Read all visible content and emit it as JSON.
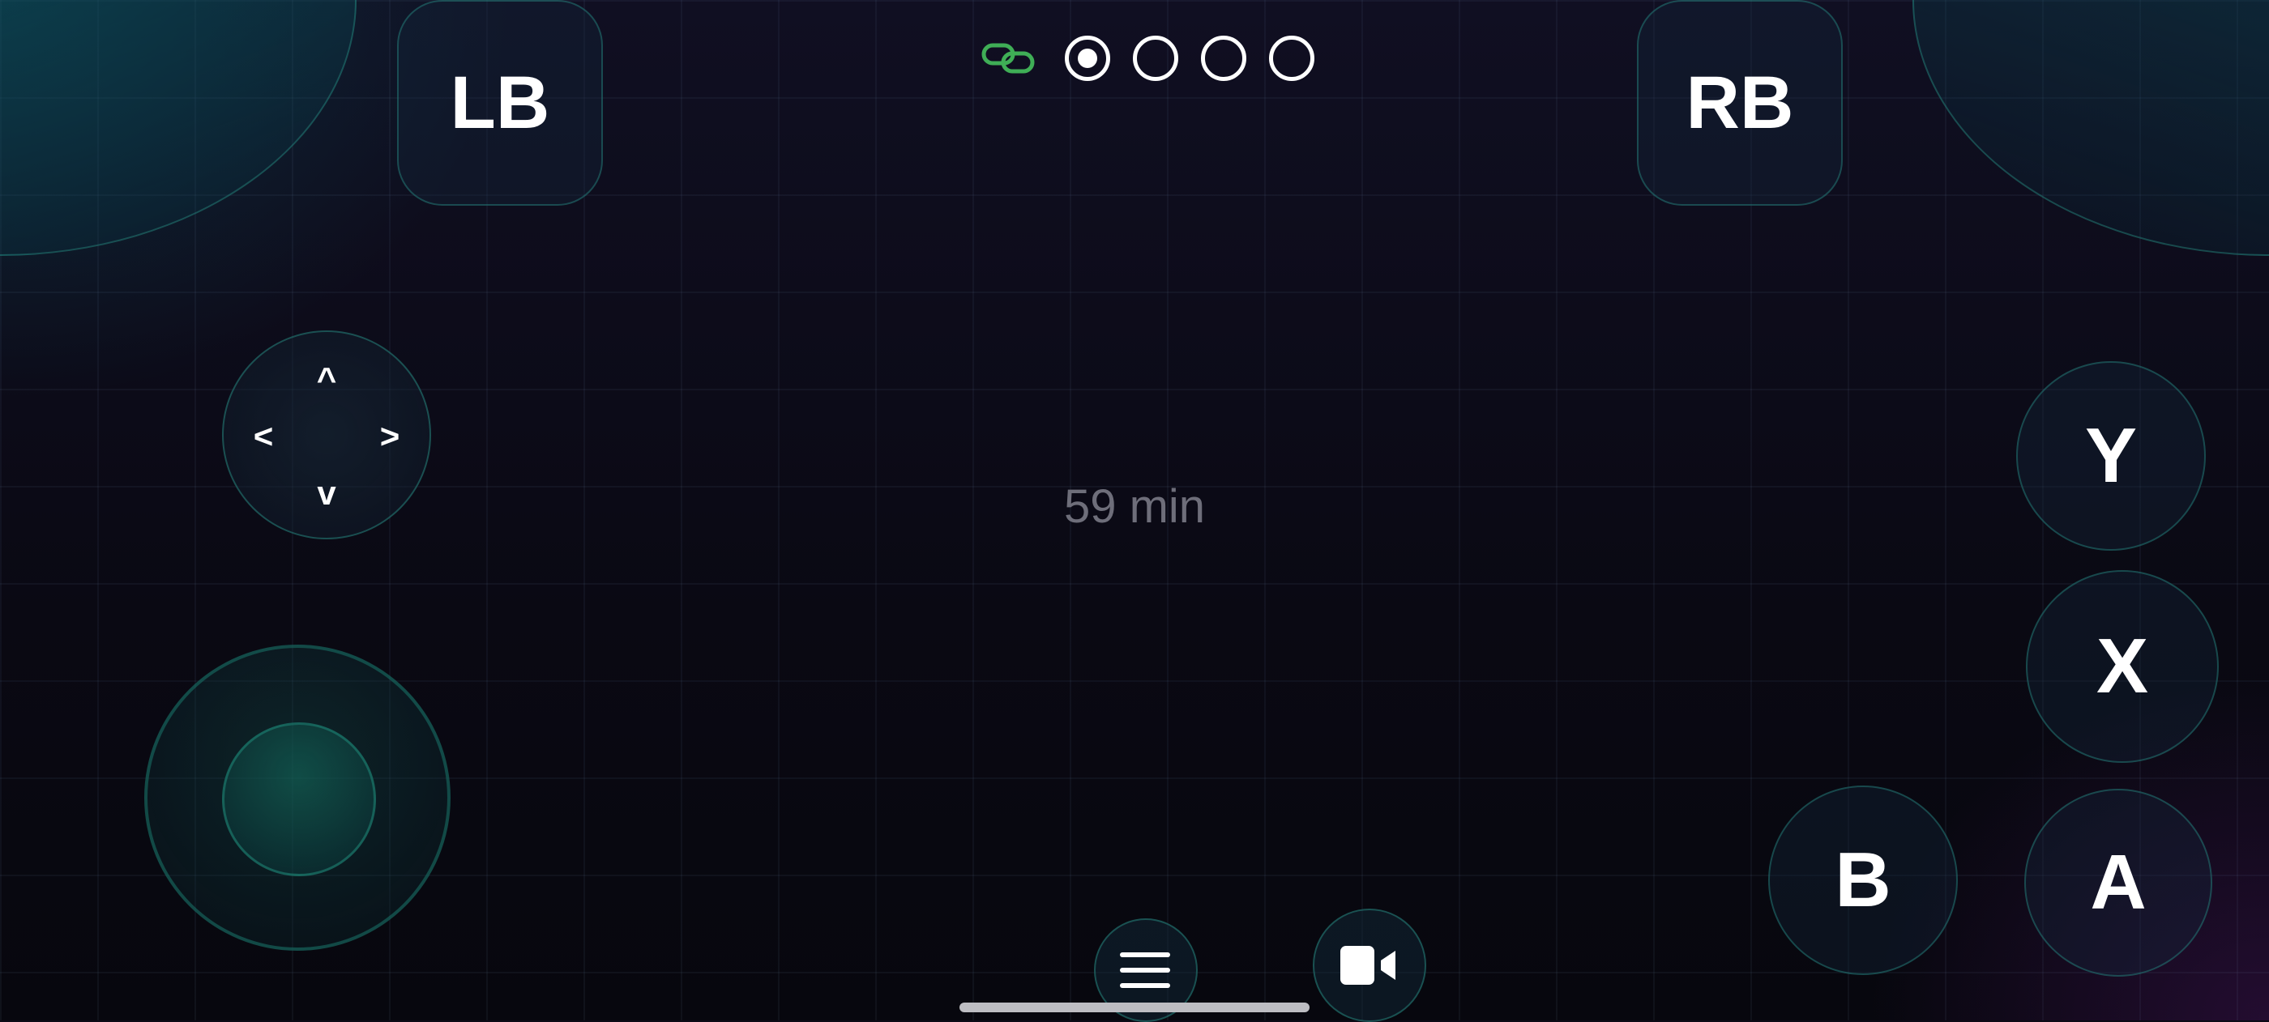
{
  "bumpers": {
    "left_label": "LB",
    "right_label": "RB"
  },
  "status": {
    "connection_icon": "link-icon",
    "connection_color": "#3fae56",
    "player_slots": [
      {
        "active": true
      },
      {
        "active": false
      },
      {
        "active": false
      },
      {
        "active": false
      }
    ]
  },
  "dpad": {
    "up": "^",
    "down": "v",
    "left": "<",
    "right": ">"
  },
  "timer": {
    "text": "59 min"
  },
  "face_buttons": {
    "y": "Y",
    "x": "X",
    "b": "B",
    "a": "A"
  },
  "bottom": {
    "menu_icon": "hamburger-menu-icon",
    "record_icon": "video-camera-icon"
  },
  "colors": {
    "accent": "#1f8c80",
    "background": "#0b0a16",
    "muted_text": "#6e6e7a"
  }
}
